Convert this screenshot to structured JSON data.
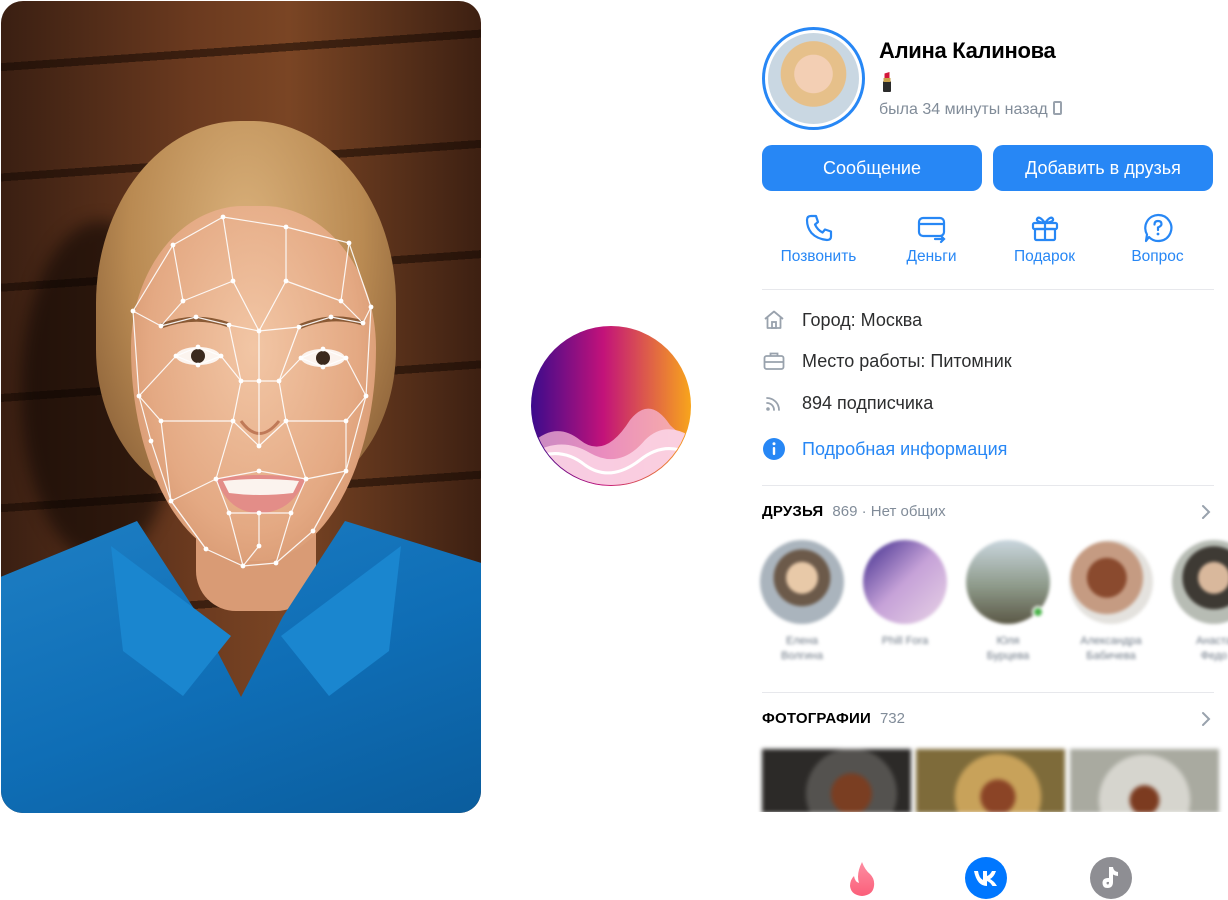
{
  "profile": {
    "name": "Алина Калинова",
    "status_emoji_icon": "lipstick-icon",
    "last_seen": "была 34 минуты назад",
    "buttons": {
      "message": "Сообщение",
      "add_friend": "Добавить в друзья"
    },
    "actions": [
      {
        "label": "Позвонить",
        "icon": "phone-icon"
      },
      {
        "label": "Деньги",
        "icon": "money-card-icon"
      },
      {
        "label": "Подарок",
        "icon": "gift-icon"
      },
      {
        "label": "Вопрос",
        "icon": "question-bubble-icon"
      }
    ],
    "info": {
      "city": "Город: Москва",
      "work": "Место работы: Питомник",
      "followers": "894 подписчика",
      "details_link": "Подробная информация"
    },
    "friends": {
      "title": "ДРУЗЬЯ",
      "count": "869 · Нет общих",
      "items": [
        {
          "name": "Елена\nВолгина"
        },
        {
          "name": "Phill Fora"
        },
        {
          "name": "Юля\nБурцева",
          "online": true
        },
        {
          "name": "Александра\nБабичева"
        },
        {
          "name": "Анаста\nФедо"
        }
      ]
    },
    "photos": {
      "title": "ФОТОГРАФИИ",
      "count": "732"
    }
  },
  "brands": [
    "tinder-logo-icon",
    "vk-logo-icon",
    "tiktok-logo-icon"
  ],
  "colors": {
    "accent": "#2787f5",
    "secondary_text": "#818c99",
    "online": "#4bb34b"
  }
}
